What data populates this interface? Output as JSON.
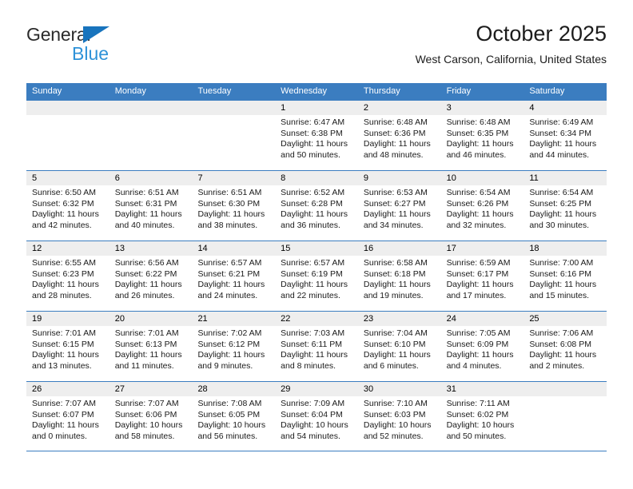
{
  "brand": {
    "line1": "General",
    "line2": "Blue",
    "triangle_color": "#1874bd",
    "text_color": "#2e92d8"
  },
  "header": {
    "title": "October 2025",
    "subtitle": "West Carson, California, United States"
  },
  "theme": {
    "header_blue": "#3b7dc0",
    "date_strip_gray": "#eeeeee",
    "text_black": "#000000"
  },
  "weekdays": [
    "Sunday",
    "Monday",
    "Tuesday",
    "Wednesday",
    "Thursday",
    "Friday",
    "Saturday"
  ],
  "labels": {
    "sunrise": "Sunrise:",
    "sunset": "Sunset:",
    "daylight": "Daylight:"
  },
  "weeks": [
    [
      {
        "empty": true
      },
      {
        "empty": true
      },
      {
        "empty": true
      },
      {
        "day": "1",
        "sunrise": "Sunrise: 6:47 AM",
        "sunset": "Sunset: 6:38 PM",
        "daylight1": "Daylight: 11 hours",
        "daylight2": "and 50 minutes."
      },
      {
        "day": "2",
        "sunrise": "Sunrise: 6:48 AM",
        "sunset": "Sunset: 6:36 PM",
        "daylight1": "Daylight: 11 hours",
        "daylight2": "and 48 minutes."
      },
      {
        "day": "3",
        "sunrise": "Sunrise: 6:48 AM",
        "sunset": "Sunset: 6:35 PM",
        "daylight1": "Daylight: 11 hours",
        "daylight2": "and 46 minutes."
      },
      {
        "day": "4",
        "sunrise": "Sunrise: 6:49 AM",
        "sunset": "Sunset: 6:34 PM",
        "daylight1": "Daylight: 11 hours",
        "daylight2": "and 44 minutes."
      }
    ],
    [
      {
        "day": "5",
        "sunrise": "Sunrise: 6:50 AM",
        "sunset": "Sunset: 6:32 PM",
        "daylight1": "Daylight: 11 hours",
        "daylight2": "and 42 minutes."
      },
      {
        "day": "6",
        "sunrise": "Sunrise: 6:51 AM",
        "sunset": "Sunset: 6:31 PM",
        "daylight1": "Daylight: 11 hours",
        "daylight2": "and 40 minutes."
      },
      {
        "day": "7",
        "sunrise": "Sunrise: 6:51 AM",
        "sunset": "Sunset: 6:30 PM",
        "daylight1": "Daylight: 11 hours",
        "daylight2": "and 38 minutes."
      },
      {
        "day": "8",
        "sunrise": "Sunrise: 6:52 AM",
        "sunset": "Sunset: 6:28 PM",
        "daylight1": "Daylight: 11 hours",
        "daylight2": "and 36 minutes."
      },
      {
        "day": "9",
        "sunrise": "Sunrise: 6:53 AM",
        "sunset": "Sunset: 6:27 PM",
        "daylight1": "Daylight: 11 hours",
        "daylight2": "and 34 minutes."
      },
      {
        "day": "10",
        "sunrise": "Sunrise: 6:54 AM",
        "sunset": "Sunset: 6:26 PM",
        "daylight1": "Daylight: 11 hours",
        "daylight2": "and 32 minutes."
      },
      {
        "day": "11",
        "sunrise": "Sunrise: 6:54 AM",
        "sunset": "Sunset: 6:25 PM",
        "daylight1": "Daylight: 11 hours",
        "daylight2": "and 30 minutes."
      }
    ],
    [
      {
        "day": "12",
        "sunrise": "Sunrise: 6:55 AM",
        "sunset": "Sunset: 6:23 PM",
        "daylight1": "Daylight: 11 hours",
        "daylight2": "and 28 minutes."
      },
      {
        "day": "13",
        "sunrise": "Sunrise: 6:56 AM",
        "sunset": "Sunset: 6:22 PM",
        "daylight1": "Daylight: 11 hours",
        "daylight2": "and 26 minutes."
      },
      {
        "day": "14",
        "sunrise": "Sunrise: 6:57 AM",
        "sunset": "Sunset: 6:21 PM",
        "daylight1": "Daylight: 11 hours",
        "daylight2": "and 24 minutes."
      },
      {
        "day": "15",
        "sunrise": "Sunrise: 6:57 AM",
        "sunset": "Sunset: 6:19 PM",
        "daylight1": "Daylight: 11 hours",
        "daylight2": "and 22 minutes."
      },
      {
        "day": "16",
        "sunrise": "Sunrise: 6:58 AM",
        "sunset": "Sunset: 6:18 PM",
        "daylight1": "Daylight: 11 hours",
        "daylight2": "and 19 minutes."
      },
      {
        "day": "17",
        "sunrise": "Sunrise: 6:59 AM",
        "sunset": "Sunset: 6:17 PM",
        "daylight1": "Daylight: 11 hours",
        "daylight2": "and 17 minutes."
      },
      {
        "day": "18",
        "sunrise": "Sunrise: 7:00 AM",
        "sunset": "Sunset: 6:16 PM",
        "daylight1": "Daylight: 11 hours",
        "daylight2": "and 15 minutes."
      }
    ],
    [
      {
        "day": "19",
        "sunrise": "Sunrise: 7:01 AM",
        "sunset": "Sunset: 6:15 PM",
        "daylight1": "Daylight: 11 hours",
        "daylight2": "and 13 minutes."
      },
      {
        "day": "20",
        "sunrise": "Sunrise: 7:01 AM",
        "sunset": "Sunset: 6:13 PM",
        "daylight1": "Daylight: 11 hours",
        "daylight2": "and 11 minutes."
      },
      {
        "day": "21",
        "sunrise": "Sunrise: 7:02 AM",
        "sunset": "Sunset: 6:12 PM",
        "daylight1": "Daylight: 11 hours",
        "daylight2": "and 9 minutes."
      },
      {
        "day": "22",
        "sunrise": "Sunrise: 7:03 AM",
        "sunset": "Sunset: 6:11 PM",
        "daylight1": "Daylight: 11 hours",
        "daylight2": "and 8 minutes."
      },
      {
        "day": "23",
        "sunrise": "Sunrise: 7:04 AM",
        "sunset": "Sunset: 6:10 PM",
        "daylight1": "Daylight: 11 hours",
        "daylight2": "and 6 minutes."
      },
      {
        "day": "24",
        "sunrise": "Sunrise: 7:05 AM",
        "sunset": "Sunset: 6:09 PM",
        "daylight1": "Daylight: 11 hours",
        "daylight2": "and 4 minutes."
      },
      {
        "day": "25",
        "sunrise": "Sunrise: 7:06 AM",
        "sunset": "Sunset: 6:08 PM",
        "daylight1": "Daylight: 11 hours",
        "daylight2": "and 2 minutes."
      }
    ],
    [
      {
        "day": "26",
        "sunrise": "Sunrise: 7:07 AM",
        "sunset": "Sunset: 6:07 PM",
        "daylight1": "Daylight: 11 hours",
        "daylight2": "and 0 minutes."
      },
      {
        "day": "27",
        "sunrise": "Sunrise: 7:07 AM",
        "sunset": "Sunset: 6:06 PM",
        "daylight1": "Daylight: 10 hours",
        "daylight2": "and 58 minutes."
      },
      {
        "day": "28",
        "sunrise": "Sunrise: 7:08 AM",
        "sunset": "Sunset: 6:05 PM",
        "daylight1": "Daylight: 10 hours",
        "daylight2": "and 56 minutes."
      },
      {
        "day": "29",
        "sunrise": "Sunrise: 7:09 AM",
        "sunset": "Sunset: 6:04 PM",
        "daylight1": "Daylight: 10 hours",
        "daylight2": "and 54 minutes."
      },
      {
        "day": "30",
        "sunrise": "Sunrise: 7:10 AM",
        "sunset": "Sunset: 6:03 PM",
        "daylight1": "Daylight: 10 hours",
        "daylight2": "and 52 minutes."
      },
      {
        "day": "31",
        "sunrise": "Sunrise: 7:11 AM",
        "sunset": "Sunset: 6:02 PM",
        "daylight1": "Daylight: 10 hours",
        "daylight2": "and 50 minutes."
      },
      {
        "empty": true
      }
    ]
  ]
}
